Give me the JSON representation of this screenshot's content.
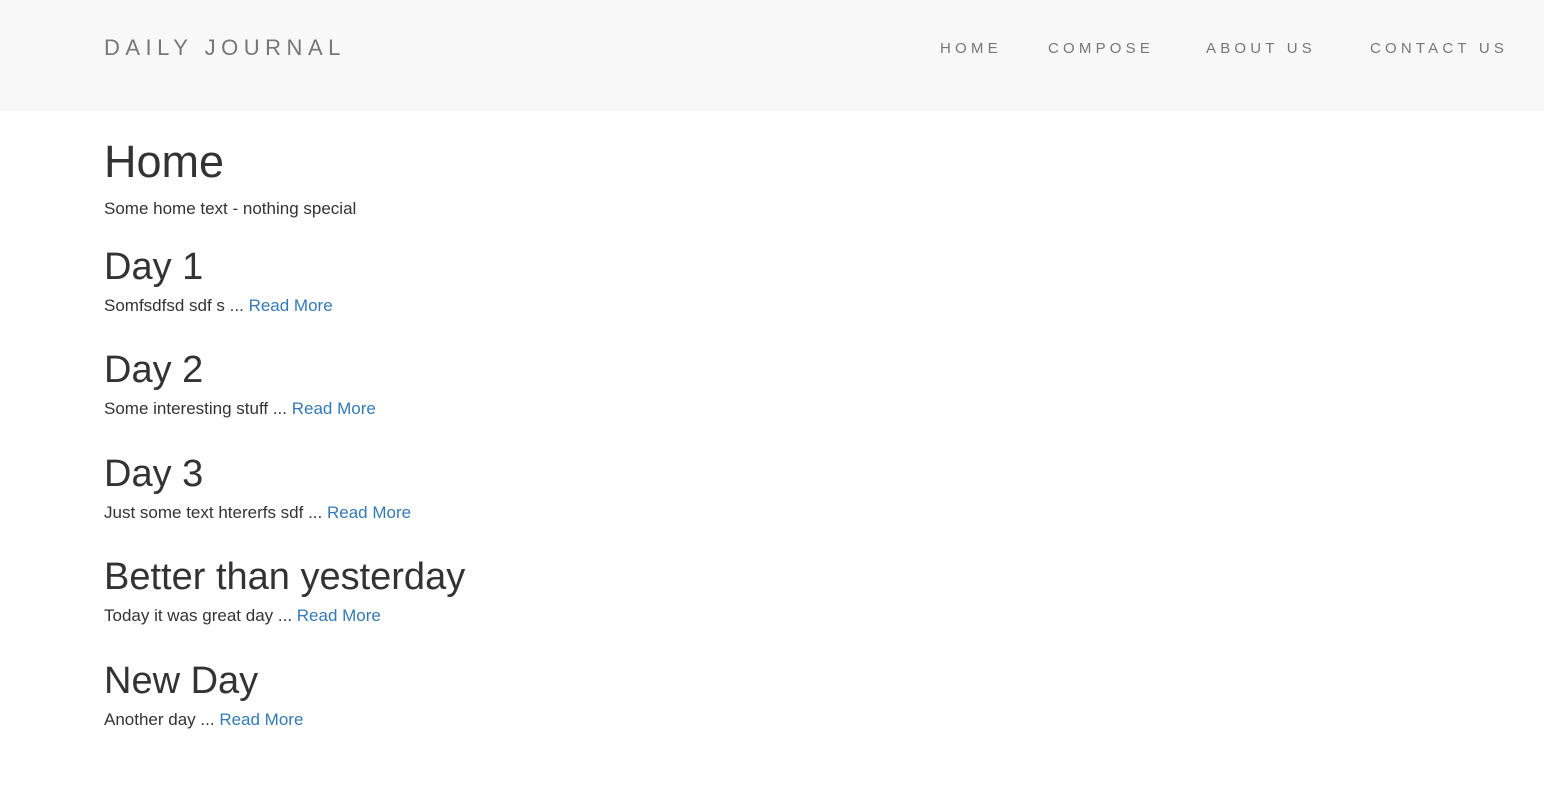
{
  "navbar": {
    "brand": "DAILY JOURNAL",
    "links": [
      {
        "label": "HOME"
      },
      {
        "label": "COMPOSE"
      },
      {
        "label": "ABOUT US"
      },
      {
        "label": "CONTACT US"
      }
    ]
  },
  "page": {
    "title": "Home",
    "text": "Some home text - nothing special"
  },
  "posts": [
    {
      "title": "Day 1",
      "excerpt": "Somfsdfsd sdf s ...",
      "link": "Read More"
    },
    {
      "title": "Day 2",
      "excerpt": "Some interesting stuff ...",
      "link": "Read More"
    },
    {
      "title": "Day 3",
      "excerpt": "Just some text htererfs sdf ...",
      "link": "Read More"
    },
    {
      "title": "Better than yesterday",
      "excerpt": "Today it was great day ...",
      "link": "Read More"
    },
    {
      "title": "New Day",
      "excerpt": "Another day ...",
      "link": "Read More"
    }
  ],
  "colors": {
    "navbar_bg": "#f8f8f8",
    "nav_text": "#777777",
    "body_text": "#333333",
    "link": "#337ab7"
  }
}
